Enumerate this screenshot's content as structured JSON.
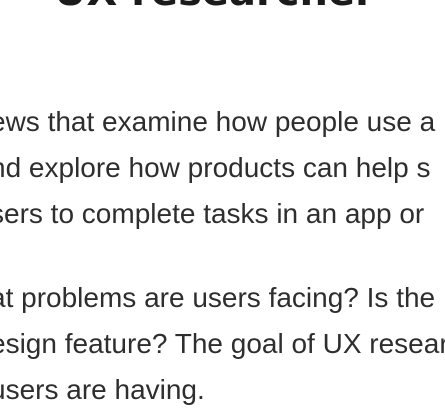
{
  "article": {
    "heading": "UX researcher",
    "paragraphs": [
      {
        "lines": [
          "ews that examine how people use a",
          "nd explore how products can help s",
          "sers to complete tasks in an app or"
        ]
      },
      {
        "lines": [
          "at problems are users facing? Is the",
          "esign feature? The goal of UX resear",
          "users are having."
        ]
      }
    ]
  }
}
